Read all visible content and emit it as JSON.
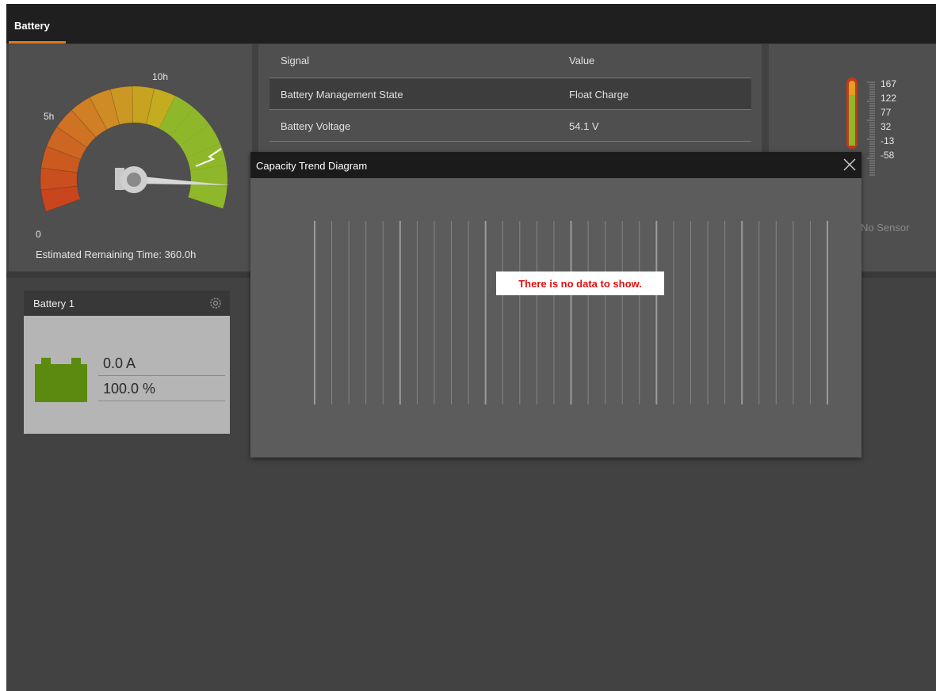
{
  "tabs": [
    {
      "label": "Battery"
    }
  ],
  "gauge": {
    "labels": {
      "zero": "0",
      "five": "5h",
      "ten": "10h"
    },
    "estimated_remaining": "Estimated Remaining Time: 360.0h",
    "colors": {
      "low": "#c8451e",
      "mid": "#c4a11c",
      "high": "#8fb72a"
    }
  },
  "signals": {
    "header": {
      "signal": "Signal",
      "value": "Value"
    },
    "rows": [
      {
        "signal": "Battery Management State",
        "value": "Float Charge"
      },
      {
        "signal": "Battery Voltage",
        "value": "54.1 V"
      }
    ]
  },
  "temperature": {
    "scale": [
      "167",
      "122",
      "77",
      "32",
      "-13",
      "-58"
    ],
    "status": "No Sensor"
  },
  "battery_card": {
    "title": "Battery 1",
    "current": "0.0 A",
    "capacity": "100.0 %",
    "icon": "battery-icon",
    "settings_icon": "gear-icon",
    "battery_color": "#5b8a10"
  },
  "dialog": {
    "title": "Capacity Trend Diagram",
    "close_icon": "close-icon",
    "no_data_message": "There is no data to show.",
    "message_color": "#e01010"
  }
}
